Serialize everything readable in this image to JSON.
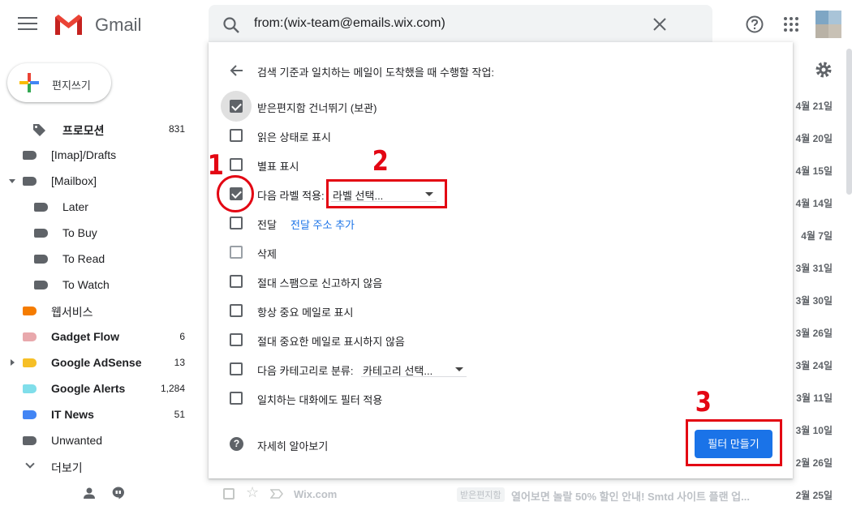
{
  "header": {
    "app_name": "Gmail",
    "search_query": "from:(wix-team@emails.wix.com)"
  },
  "sidebar": {
    "compose_label": "편지쓰기",
    "items": [
      {
        "label": "프로모션",
        "count": "831",
        "bold": true,
        "color": "#5f6368"
      },
      {
        "label": "[Imap]/Drafts",
        "count": "",
        "bold": false,
        "color": "#5f6368"
      },
      {
        "label": "[Mailbox]",
        "count": "",
        "bold": false,
        "color": "#5f6368"
      },
      {
        "label": "Later",
        "count": "",
        "bold": false,
        "color": "#5f6368"
      },
      {
        "label": "To Buy",
        "count": "",
        "bold": false,
        "color": "#5f6368"
      },
      {
        "label": "To Read",
        "count": "",
        "bold": false,
        "color": "#5f6368"
      },
      {
        "label": "To Watch",
        "count": "",
        "bold": false,
        "color": "#5f6368"
      },
      {
        "label": "웹서비스",
        "count": "",
        "bold": false,
        "color": "#f57c00"
      },
      {
        "label": "Gadget Flow",
        "count": "6",
        "bold": true,
        "color": "#e8a8ac"
      },
      {
        "label": "Google AdSense",
        "count": "13",
        "bold": true,
        "color": "#f6bf26"
      },
      {
        "label": "Google Alerts",
        "count": "1,284",
        "bold": true,
        "color": "#80deea"
      },
      {
        "label": "IT News",
        "count": "51",
        "bold": true,
        "color": "#4285f4"
      },
      {
        "label": "Unwanted",
        "count": "",
        "bold": false,
        "color": "#5f6368"
      },
      {
        "label": "더보기",
        "count": "",
        "bold": false,
        "color": ""
      }
    ]
  },
  "filter_dialog": {
    "title": "검색 기준과 일치하는 메일이 도착했을 때 수행할 작업:",
    "options": [
      {
        "label": "받은편지함 건너뛰기 (보관)",
        "checked": true
      },
      {
        "label": "읽은 상태로 표시",
        "checked": false
      },
      {
        "label": "별표 표시",
        "checked": false
      },
      {
        "label": "다음 라벨 적용:",
        "checked": true
      },
      {
        "label": "전달",
        "checked": false
      },
      {
        "label": "삭제",
        "checked": false
      },
      {
        "label": "절대 스팸으로 신고하지 않음",
        "checked": false
      },
      {
        "label": "항상 중요 메일로 표시",
        "checked": false
      },
      {
        "label": "절대 중요한 메일로 표시하지 않음",
        "checked": false
      },
      {
        "label": "다음 카테고리로 분류:",
        "checked": false
      },
      {
        "label": "일치하는 대화에도 필터 적용",
        "checked": false
      }
    ],
    "label_select": "라벨 선택...",
    "forward_link": "전달 주소 추가",
    "category_select": "카테고리 선택...",
    "learn_more": "자세히 알아보기",
    "create_button": "필터 만들기"
  },
  "annotations": {
    "n1": "1",
    "n2": "2",
    "n3": "3",
    "color": "#e30613"
  },
  "mail_list": {
    "dates": [
      "4월 21일",
      "4월 20일",
      "4월 15일",
      "4월 14일",
      "4월 7일",
      "3월 31일",
      "3월 30일",
      "3월 26일",
      "3월 24일",
      "3월 11일",
      "3월 10일",
      "2월 26일",
      "2월 25일"
    ],
    "bottom_row": {
      "sender": "Wix.com",
      "badge": "받은편지함",
      "subject": "열어보면 놀랄 50% 할인 안내! Smtd 사이트 플랜 업..."
    }
  }
}
